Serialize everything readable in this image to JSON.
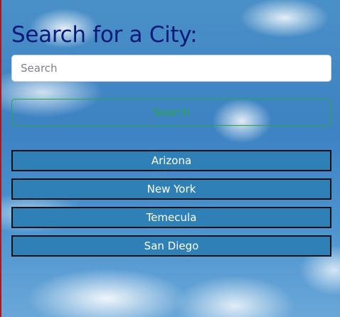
{
  "page": {
    "title": "Search for a City:"
  },
  "search": {
    "placeholder": "Search",
    "value": "",
    "button_label": "Search"
  },
  "cities": [
    {
      "label": "Arizona"
    },
    {
      "label": "New York"
    },
    {
      "label": "Temecula"
    },
    {
      "label": "San Diego"
    }
  ],
  "colors": {
    "title": "#0b1a7a",
    "search_button_outline": "#28a745",
    "city_button_bg": "#2f80b6",
    "city_button_border": "#0f1216",
    "sky": "#3d82c2"
  },
  "icons": {
    "background": "sky-clouds-image"
  }
}
